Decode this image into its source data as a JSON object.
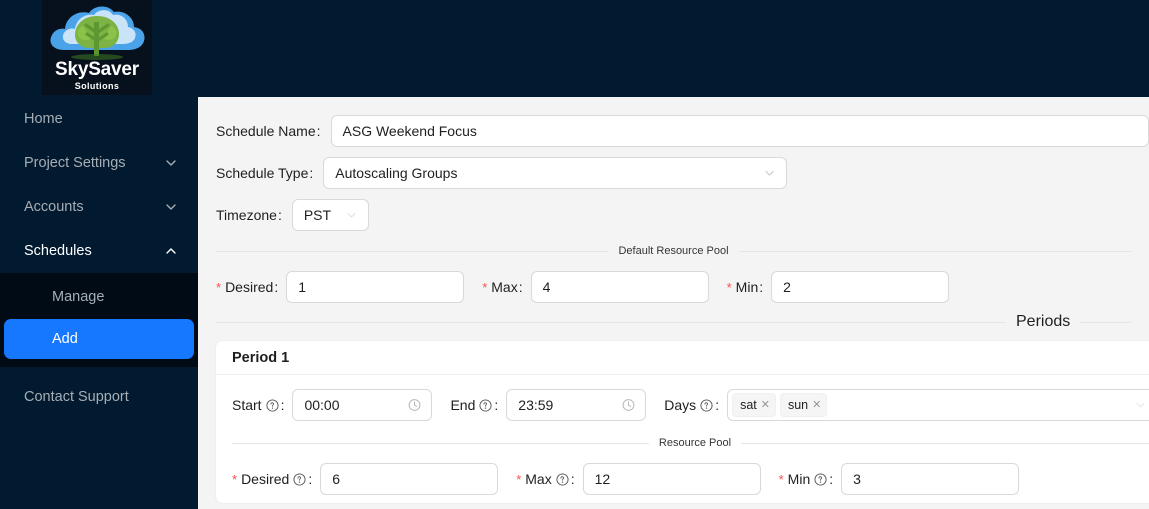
{
  "brand": {
    "wordmark": "SkySaver",
    "sub": "Solutions",
    "logo_icon": "cloud-tree-logo",
    "cloud_color": "#4aa3e8",
    "tree_color": "#7cb342"
  },
  "sidebar": {
    "accent": "#1677ff",
    "bg": "#011A2F",
    "submenu_bg": "#000B15",
    "items": [
      {
        "label": "Home",
        "icon": null,
        "expandable": false,
        "active": false
      },
      {
        "label": "Project Settings",
        "icon": "chevron-down-icon",
        "expandable": true,
        "active": false
      },
      {
        "label": "Accounts",
        "icon": "chevron-down-icon",
        "expandable": true,
        "active": false
      },
      {
        "label": "Schedules",
        "icon": "chevron-up-icon",
        "expandable": true,
        "active": true
      }
    ],
    "submenu": [
      {
        "label": "Manage",
        "selected": false
      },
      {
        "label": "Add",
        "selected": true
      }
    ],
    "support": {
      "label": "Contact Support"
    }
  },
  "form": {
    "schedule_name": {
      "label": "Schedule Name",
      "value": "ASG Weekend Focus",
      "placeholder": "Schedule Name"
    },
    "schedule_type": {
      "label": "Schedule Type",
      "value": "Autoscaling Groups",
      "icon": "chevron-down-icon"
    },
    "timezone": {
      "label": "Timezone",
      "value": "PST",
      "icon": "chevron-down-icon"
    },
    "default_pool": {
      "legend": "Default Resource Pool",
      "fields": [
        {
          "label": "Desired",
          "value": "1",
          "required": true,
          "help": false
        },
        {
          "label": "Max",
          "value": "4",
          "required": true,
          "help": false
        },
        {
          "label": "Min",
          "value": "2",
          "required": true,
          "help": false
        }
      ]
    },
    "periods_legend": "Periods",
    "periods": [
      {
        "title": "Period 1",
        "start": {
          "label": "Start",
          "value": "00:00",
          "help_icon": "question-circle-icon",
          "suffix_icon": "clock-icon"
        },
        "end": {
          "label": "End",
          "value": "23:59",
          "help_icon": "question-circle-icon",
          "suffix_icon": "clock-icon"
        },
        "days": {
          "label": "Days",
          "help_icon": "question-circle-icon",
          "tags": [
            "sat",
            "sun"
          ],
          "icon": "chevron-down-icon"
        },
        "pool": {
          "legend": "Resource Pool",
          "fields": [
            {
              "label": "Desired",
              "value": "6",
              "required": true,
              "help": true
            },
            {
              "label": "Max",
              "value": "12",
              "required": true,
              "help": true
            },
            {
              "label": "Min",
              "value": "3",
              "required": true,
              "help": true
            }
          ]
        }
      }
    ],
    "required_marker": "*",
    "colon": ":"
  }
}
